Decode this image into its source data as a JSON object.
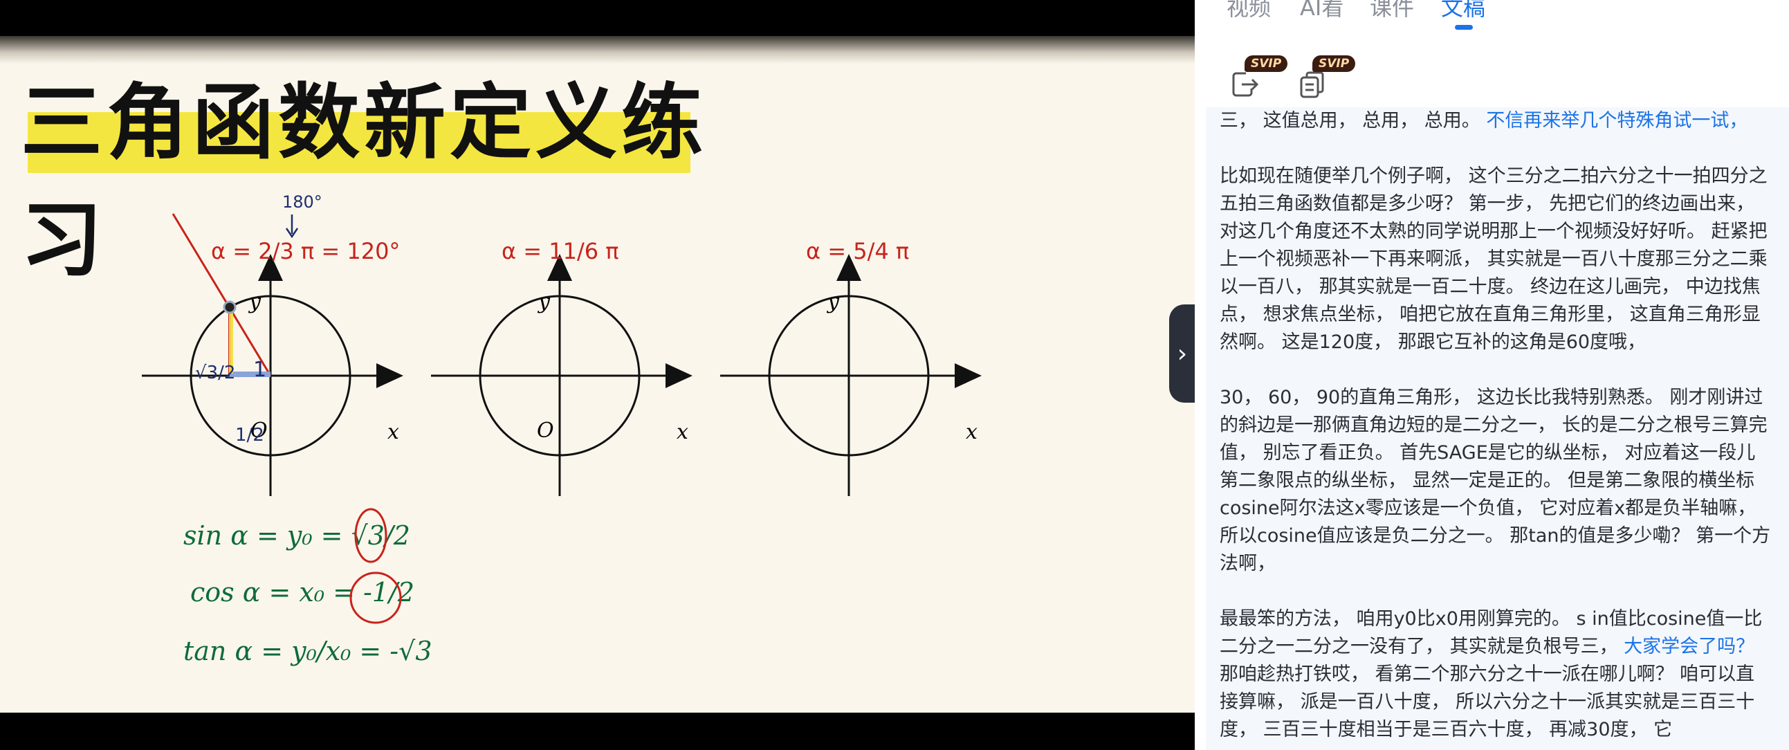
{
  "video": {
    "slide_title": "三角函数新定义练习",
    "diagram": {
      "axis_x": "x",
      "axis_y": "y",
      "origin": "O",
      "fig1_angle": "α = 2/3 π = 120°",
      "fig1_note": "180°",
      "fig2_angle": "α = 11/6 π",
      "fig3_angle": "α = 5/4 π",
      "point_y_label": "√3/2",
      "point_x_label": "1/2",
      "radius_label": "1",
      "sin_line": "sin α = y₀ = √3/2",
      "cos_line": "cos α = x₀ = -1/2",
      "tan_line": "tan α = y₀/x₀ = -√3"
    }
  },
  "panel": {
    "tabs": [
      "视频",
      "AI看",
      "课件",
      "文稿"
    ],
    "active_tab": "文稿",
    "svip_badge": "SVIP",
    "tools": [
      "export-icon",
      "copy-icon"
    ],
    "collapse_icon": "chevron-right-icon",
    "paragraphs": [
      {
        "segments": [
          {
            "text": "三， 这值总用， 总用， 总用。 ",
            "highlight": false
          },
          {
            "text": "不信再来举几个特殊角试一试，",
            "highlight": true
          }
        ]
      },
      {
        "segments": [
          {
            "text": "比如现在随便举几个例子啊， 这个三分之二拍六分之十一拍四分之五拍三角函数值都是多少呀？ 第一步， 先把它们的终边画出来， 对这几个角度还不太熟的同学说明那上一个视频没好好听。 赶紧把上一个视频恶补一下再来啊派， 其实就是一百八十度那三分之二乘以一百八， 那其实就是一百二十度。 终边在这儿画完， 中边找焦点， 想求焦点坐标， 咱把它放在直角三角形里， 这直角三角形显然啊。 这是120度， 那跟它互补的这角是60度哦，",
            "highlight": false
          }
        ]
      },
      {
        "segments": [
          {
            "text": "30， 60， 90的直角三角形， 这边长比我特别熟悉。 刚才刚讲过的斜边是一那俩直角边短的是二分之一， 长的是二分之根号三算完值， 别忘了看正负。 首先SAGE是它的纵坐标， 对应着这一段儿第二象限点的纵坐标， 显然一定是正的。 但是第二象限的横坐标cosine阿尔法这x零应该是一个负值， 它对应着x都是负半轴嘛， 所以cosine值应该是负二分之一。 那tan的值是多少嘞？ 第一个方法啊，",
            "highlight": false
          }
        ]
      },
      {
        "segments": [
          {
            "text": "最最笨的方法， 咱用y0比x0用刚算完的。 s in值比cosine值一比二分之一二分之一没有了， 其实就是负根号三， ",
            "highlight": false
          },
          {
            "text": "大家学会了吗？",
            "highlight": true
          },
          {
            "text": " 那咱趁热打铁哎， 看第二个那六分之十一派在哪儿啊？ 咱可以直接算嘛， 派是一百八十度， 所以六分之十一派其实就是三百三十度， 三百三十度相当于是三百六十度， 再减30度， 它",
            "highlight": false
          }
        ]
      }
    ],
    "colors": {
      "accent": "#1a73e8",
      "svip_bg": "#3b1c12",
      "svip_text": "#ffd9a0"
    }
  }
}
